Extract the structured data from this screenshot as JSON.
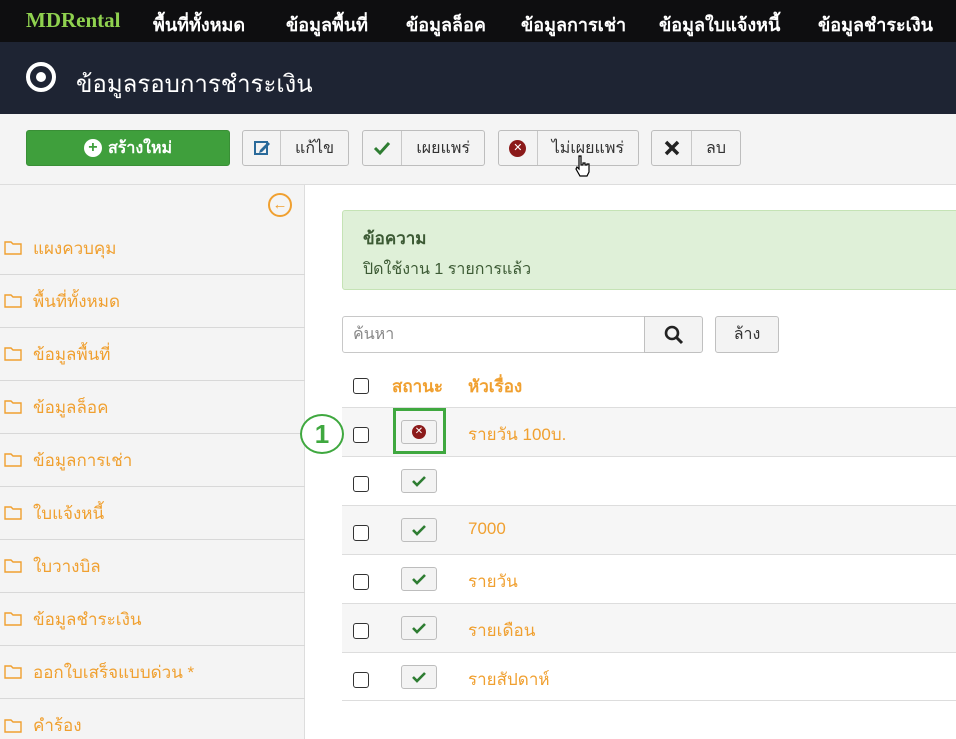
{
  "topnav": {
    "brand": "MDRental",
    "items": [
      "พื้นที่ทั้งหมด",
      "ข้อมูลพื้นที่",
      "ข้อมูลล็อค",
      "ข้อมูลการเช่า",
      "ข้อมูลใบแจ้งหนี้",
      "ข้อมูลชำระเงิน"
    ]
  },
  "page": {
    "title": "ข้อมูลรอบการชำระเงิน"
  },
  "toolbar": {
    "new": "สร้างใหม่",
    "edit": "แก้ไข",
    "publish": "เผยแพร่",
    "unpublish": "ไม่เผยแพร่",
    "delete": "ลบ"
  },
  "sidebar": {
    "items": [
      {
        "label": "แผงควบคุม"
      },
      {
        "label": "พื้นที่ทั้งหมด"
      },
      {
        "label": "ข้อมูลพื้นที่"
      },
      {
        "label": "ข้อมูลล็อค"
      },
      {
        "label": "ข้อมูลการเช่า"
      },
      {
        "label": "ใบแจ้งหนี้"
      },
      {
        "label": "ใบวางบิล"
      },
      {
        "label": "ข้อมูลชำระเงิน"
      },
      {
        "label": "ออกใบเสร็จแบบด่วน *"
      },
      {
        "label": "คำร้อง"
      }
    ]
  },
  "message": {
    "heading": "ข้อความ",
    "body": "ปิดใช้งาน 1 รายการแล้ว"
  },
  "search": {
    "placeholder": "ค้นหา",
    "clear": "ล้าง"
  },
  "table": {
    "headers": {
      "status": "สถานะ",
      "title": "หัวเรื่อง"
    },
    "rows": [
      {
        "title": "รายวัน 100บ.",
        "published": false
      },
      {
        "title": "",
        "published": true
      },
      {
        "title": "7000",
        "published": true
      },
      {
        "title": "รายวัน",
        "published": true
      },
      {
        "title": "รายเดือน",
        "published": true
      },
      {
        "title": "รายสัปดาห์",
        "published": true
      }
    ]
  },
  "annotation": {
    "step": "1"
  },
  "colors": {
    "accent": "#f0a030",
    "brand_green": "#8fd14f",
    "success": "#3f9f3c",
    "danger": "#8b1a1a",
    "message_bg": "#dff0d8"
  }
}
